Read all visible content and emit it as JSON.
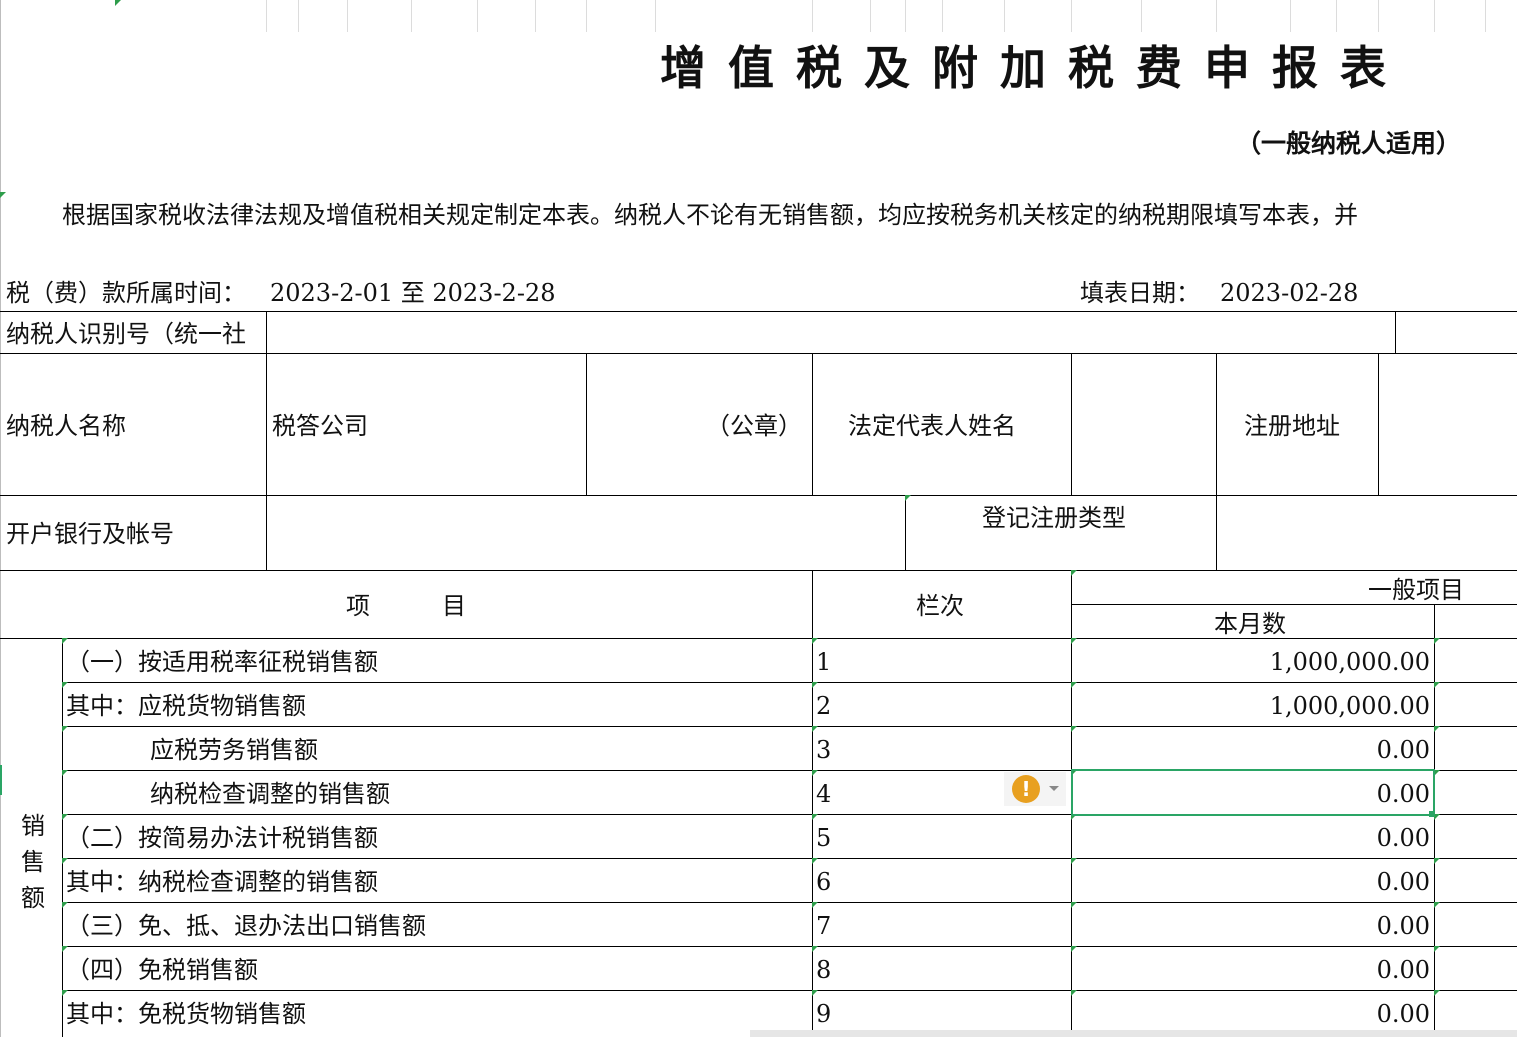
{
  "title": "增值税及附加税费申报表",
  "subtitle": "（一般纳税人适用）",
  "intro": "根据国家税收法律法规及增值税相关规定制定本表。纳税人不论有无销售额，均应按税务机关核定的纳税期限填写本表，并",
  "period": {
    "label": "税（费）款所属时间：",
    "value": "2023-2-01 至 2023-2-28",
    "fill_date_label": "填表日期：",
    "fill_date": "2023-02-28"
  },
  "taxpayer": {
    "id_label": "纳税人识别号（统一社",
    "name_label": "纳税人名称",
    "name_value": "税答公司",
    "seal_label": "（公章）",
    "legal_rep_label": "法定代表人姓名",
    "reg_address_label": "注册地址",
    "bank_label": "开户银行及帐号",
    "reg_type_label": "登记注册类型"
  },
  "table": {
    "header_item": "项　　　目",
    "header_line": "栏次",
    "header_general": "一般项目",
    "header_month": "本月数",
    "group_label": "销售额",
    "rows": [
      {
        "label": "（一）按适用税率征税销售额",
        "line": "1",
        "amount": "1,000,000.00"
      },
      {
        "label": "其中：应税货物销售额",
        "line": "2",
        "amount": "1,000,000.00"
      },
      {
        "label": "应税劳务销售额",
        "line": "3",
        "amount": "0.00"
      },
      {
        "label": "纳税检查调整的销售额",
        "line": "4",
        "amount": "0.00"
      },
      {
        "label": "（二）按简易办法计税销售额",
        "line": "5",
        "amount": "0.00"
      },
      {
        "label": "其中：纳税检查调整的销售额",
        "line": "6",
        "amount": "0.00"
      },
      {
        "label": "（三）免、抵、退办法出口销售额",
        "line": "7",
        "amount": "0.00"
      },
      {
        "label": "（四）免税销售额",
        "line": "8",
        "amount": "0.00"
      },
      {
        "label": "其中：免税货物销售额",
        "line": "9",
        "amount": "0.00"
      }
    ]
  },
  "warning_icon": "warning-icon"
}
